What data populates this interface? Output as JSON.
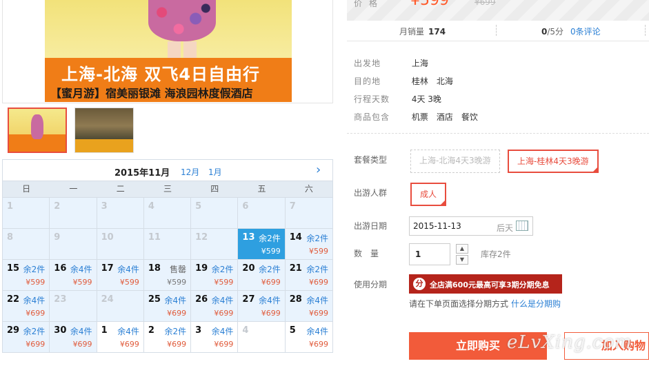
{
  "banner": {
    "title": "上海-北海  双飞4日自由行",
    "subtitle": "【蜜月游】宿美丽银滩 海浪园林度假酒店"
  },
  "price": {
    "label": "价格",
    "current": "¥599",
    "original": "¥699"
  },
  "stats": {
    "monthly_sales_label": "月销量",
    "monthly_sales_value": "174",
    "score_value": "0",
    "score_suffix": "/5分",
    "reviews_link": "0条评论"
  },
  "info": {
    "rows": [
      {
        "label": "出发地",
        "values": [
          "上海"
        ]
      },
      {
        "label": "目的地",
        "values": [
          "桂林",
          "北海"
        ]
      },
      {
        "label": "行程天数",
        "values": [
          "4天 3晚"
        ]
      },
      {
        "label": "商品包含",
        "values": [
          "机票",
          "酒店",
          "餐饮"
        ]
      }
    ]
  },
  "options": {
    "package_label": "套餐类型",
    "packages": [
      {
        "label": "上海-北海4天3晚游",
        "selected": false
      },
      {
        "label": "上海-桂林4天3晚游",
        "selected": true
      }
    ],
    "group_label": "出游人群",
    "groups": [
      {
        "label": "成人",
        "selected": true
      }
    ],
    "date_label": "出游日期",
    "date_value": "2015-11-13",
    "date_week": "后天",
    "qty_label": "数量",
    "qty_value": "1",
    "qty_stock": "库存2件",
    "install_label": "使用分期",
    "install_badge": "全店满600元最高可享3期分期免息",
    "install_note": "请在下单页面选择分期方式",
    "install_link": "什么是分期购"
  },
  "actions": {
    "buy": "立即购买",
    "cart": "加入购物",
    "watermark": "eLvXing.com"
  },
  "calendar": {
    "month_title": "2015年11月",
    "next_months": [
      "12月",
      "1月"
    ],
    "weekdays": [
      "日",
      "一",
      "二",
      "三",
      "四",
      "五",
      "六"
    ],
    "cells": [
      {
        "day": "1",
        "state": "past"
      },
      {
        "day": "2",
        "state": "past"
      },
      {
        "day": "3",
        "state": "past"
      },
      {
        "day": "4",
        "state": "past"
      },
      {
        "day": "5",
        "state": "past"
      },
      {
        "day": "6",
        "state": "past"
      },
      {
        "day": "7",
        "state": "past"
      },
      {
        "day": "8",
        "state": "past"
      },
      {
        "day": "9",
        "state": "past"
      },
      {
        "day": "10",
        "state": "past"
      },
      {
        "day": "11",
        "state": "past"
      },
      {
        "day": "12",
        "state": "past"
      },
      {
        "day": "13",
        "state": "sel",
        "stock": "余2件",
        "price": "¥599"
      },
      {
        "day": "14",
        "state": "avail",
        "stock": "余2件",
        "price": "¥599"
      },
      {
        "day": "15",
        "state": "avail",
        "stock": "余2件",
        "price": "¥599"
      },
      {
        "day": "16",
        "state": "avail",
        "stock": "余4件",
        "price": "¥599"
      },
      {
        "day": "17",
        "state": "avail",
        "stock": "余4件",
        "price": "¥599"
      },
      {
        "day": "18",
        "state": "sold",
        "stock": "售罄",
        "price": "¥599"
      },
      {
        "day": "19",
        "state": "avail",
        "stock": "余2件",
        "price": "¥599"
      },
      {
        "day": "20",
        "state": "avail",
        "stock": "余2件",
        "price": "¥699"
      },
      {
        "day": "21",
        "state": "avail",
        "stock": "余2件",
        "price": "¥699"
      },
      {
        "day": "22",
        "state": "avail",
        "stock": "余4件",
        "price": "¥699"
      },
      {
        "day": "23",
        "state": "empty"
      },
      {
        "day": "24",
        "state": "empty"
      },
      {
        "day": "25",
        "state": "avail",
        "stock": "余4件",
        "price": "¥699"
      },
      {
        "day": "26",
        "state": "avail",
        "stock": "余4件",
        "price": "¥699"
      },
      {
        "day": "27",
        "state": "avail",
        "stock": "余4件",
        "price": "¥699"
      },
      {
        "day": "28",
        "state": "avail",
        "stock": "余4件",
        "price": "¥699"
      },
      {
        "day": "29",
        "state": "avail",
        "stock": "余2件",
        "price": "¥699"
      },
      {
        "day": "30",
        "state": "avail",
        "stock": "余4件",
        "price": "¥699"
      },
      {
        "day": "1",
        "state": "nextm",
        "stock": "余4件",
        "price": "¥699"
      },
      {
        "day": "2",
        "state": "nextm",
        "stock": "余2件",
        "price": "¥699"
      },
      {
        "day": "3",
        "state": "nextm",
        "stock": "余4件",
        "price": "¥699"
      },
      {
        "day": "4",
        "state": "nextm-empty"
      },
      {
        "day": "5",
        "state": "nextm",
        "stock": "余4件",
        "price": "¥699"
      }
    ]
  }
}
